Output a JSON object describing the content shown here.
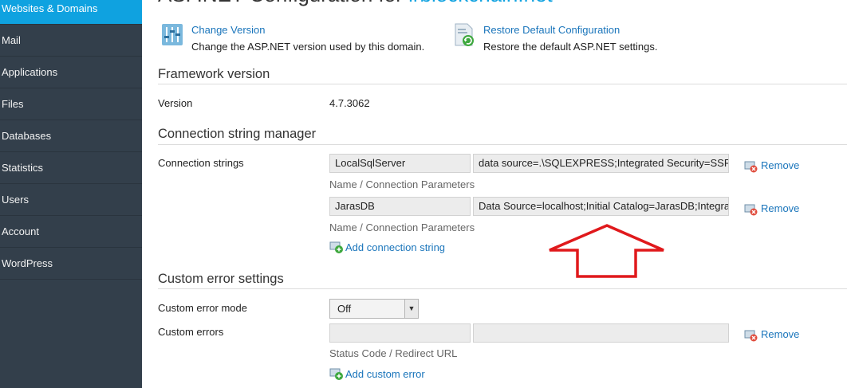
{
  "sidebar": {
    "items": [
      {
        "label": "Websites & Domains",
        "active": true
      },
      {
        "label": "Mail"
      },
      {
        "label": "Applications"
      },
      {
        "label": "Files"
      },
      {
        "label": "Databases"
      },
      {
        "label": "Statistics"
      },
      {
        "label": "Users"
      },
      {
        "label": "Account"
      },
      {
        "label": "WordPress"
      }
    ]
  },
  "page": {
    "title_prefix": "ASP.NET Configuration for ",
    "title_domain": "irblockchain.net"
  },
  "actions": {
    "change_version": {
      "label": "Change Version",
      "description": "Change the ASP.NET version used by this domain.",
      "icon": "sliders-icon"
    },
    "restore_default": {
      "label": "Restore Default Configuration",
      "description": "Restore the default ASP.NET settings.",
      "icon": "document-refresh-icon"
    }
  },
  "framework": {
    "section_title": "Framework version",
    "version_label": "Version",
    "version_value": "4.7.3062"
  },
  "connection_strings": {
    "section_title": "Connection string manager",
    "label": "Connection strings",
    "entries": [
      {
        "name": "LocalSqlServer",
        "parameters": "data source=.\\SQLEXPRESS;Integrated Security=SSPI",
        "hint": "Name / Connection Parameters",
        "remove_label": "Remove"
      },
      {
        "name": "JarasDB",
        "parameters": "Data Source=localhost;Initial Catalog=JarasDB;Integrated Security=True",
        "hint": "Name / Connection Parameters",
        "remove_label": "Remove"
      }
    ],
    "add_label": "Add connection string"
  },
  "custom_errors": {
    "section_title": "Custom error settings",
    "mode_label": "Custom error mode",
    "mode_value": "Off",
    "errors_label": "Custom errors",
    "status_code_value": "",
    "redirect_url_value": "",
    "hint": "Status Code / Redirect URL",
    "remove_label": "Remove",
    "add_label": "Add custom error"
  },
  "colors": {
    "sidebar_bg": "#333f4b",
    "sidebar_active": "#0fa2e0",
    "link": "#1a75bb",
    "annotation_arrow": "#e0191c"
  }
}
